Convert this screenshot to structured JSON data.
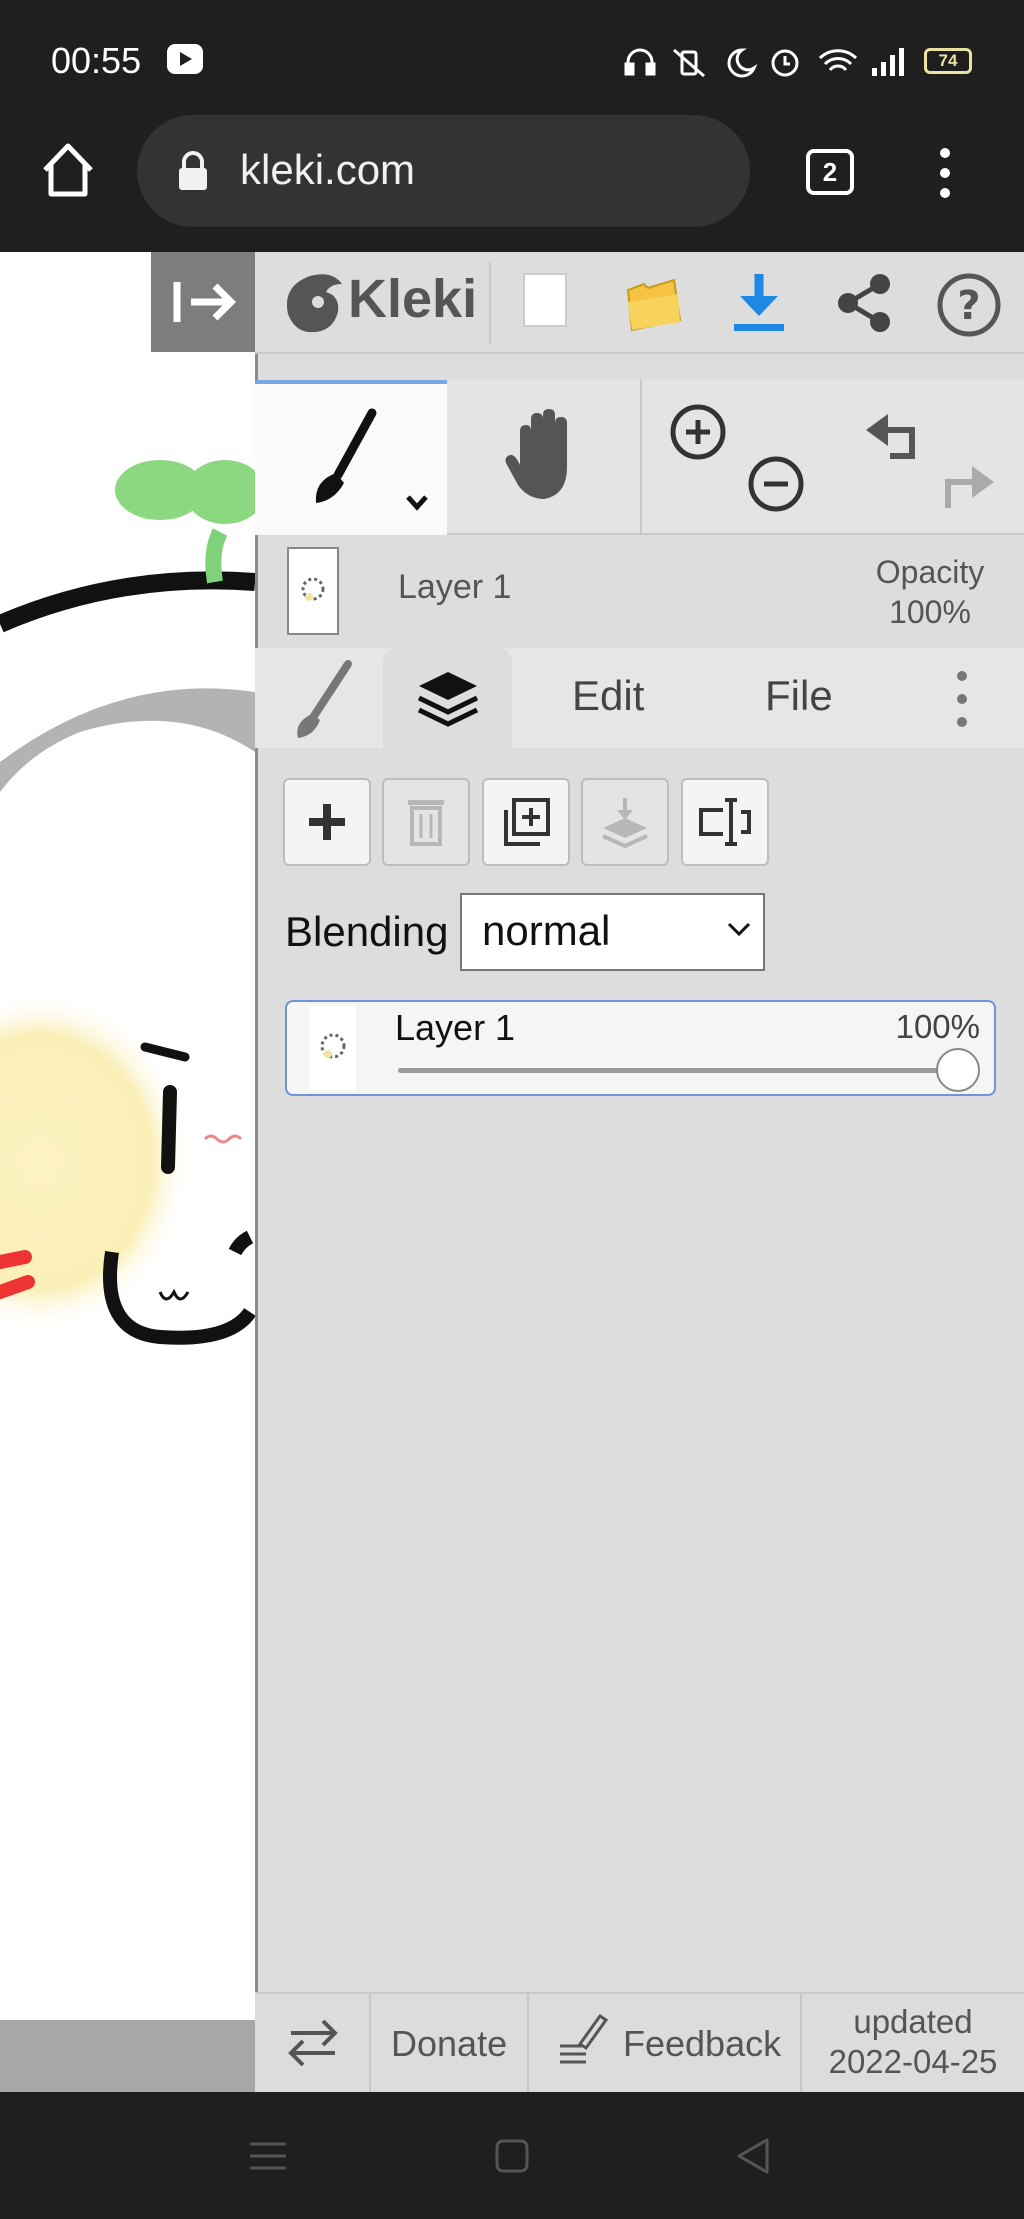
{
  "status_bar": {
    "time": "00:55",
    "battery": "74"
  },
  "browser": {
    "url": "kleki.com",
    "tab_count": "2"
  },
  "app": {
    "logo_text": "Kleki",
    "accent_color": "#1e88e5",
    "toolbar": {
      "new_icon": "new-document-icon",
      "open_icon": "folder-icon",
      "download_icon": "download-icon",
      "share_icon": "share-icon",
      "help_icon": "help-icon"
    },
    "current_layer": {
      "name": "Layer 1",
      "opacity_label": "Opacity",
      "opacity_value": "100%"
    },
    "tabs": {
      "edit": "Edit",
      "file": "File"
    },
    "layers_panel": {
      "blending_label": "Blending",
      "blending_value": "normal",
      "layers": [
        {
          "name": "Layer 1",
          "opacity": "100%",
          "opacity_fraction": 1.0
        }
      ]
    },
    "bottom_bar": {
      "donate": "Donate",
      "feedback": "Feedback",
      "updated_label": "updated",
      "updated_date": "2022-04-25"
    }
  }
}
